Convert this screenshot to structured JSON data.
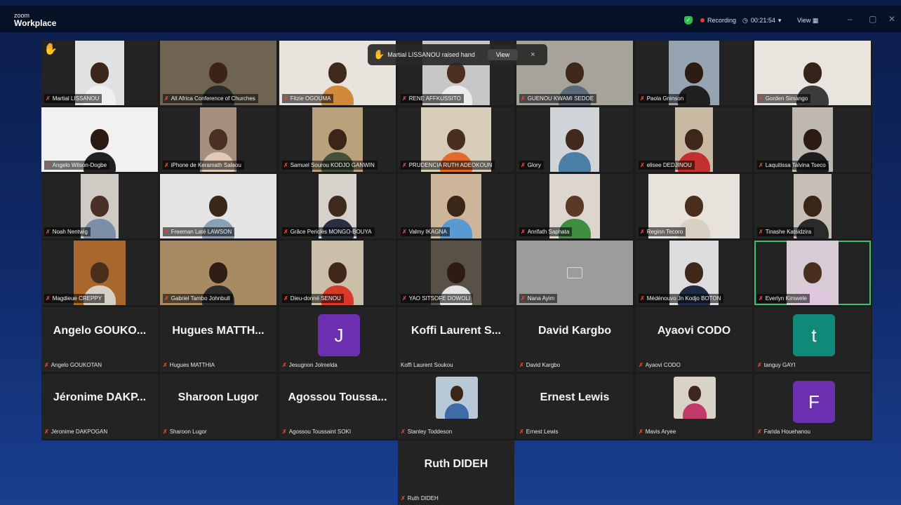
{
  "app": {
    "brand_small": "zoom",
    "brand_title": "Workplace"
  },
  "toolbar": {
    "recording": "Recording",
    "timer": "00:21:54",
    "timer_caret": "▾",
    "view": "View ▦",
    "minimize": "–",
    "maximize": "▢",
    "close": "✕"
  },
  "notification": {
    "text": "Martial LISSANOU raised hand",
    "view_label": "View",
    "close_label": "×"
  },
  "video_tiles": [
    {
      "name": "Martial LISSANOU",
      "bg": "#dfe1e2",
      "skin": "#3b261b",
      "shirt": "#f0f0f0",
      "hand": true
    },
    {
      "name": "All Africa Conference of Churches",
      "bg": "#6f6452",
      "skin": "#3a2417",
      "shirt": "#2b2b2b"
    },
    {
      "name": "Fitzie OGOUMA",
      "bg": "#e8e3dd",
      "skin": "#3f2a1b",
      "shirt": "#d08a3a"
    },
    {
      "name": "RENE AFFKUSSITO",
      "bg": "#c7c7c7",
      "skin": "#4b2f20",
      "shirt": "#ececec"
    },
    {
      "name": "GUENOU KWAMI SEDOE",
      "bg": "#a7a39b",
      "skin": "#3d281b",
      "shirt": "#5b6b7a"
    },
    {
      "name": "Paola Gninson",
      "bg": "#96a3b1",
      "skin": "#2d1c13",
      "shirt": "#202020"
    },
    {
      "name": "Gorden Simango",
      "bg": "#e9e4de",
      "skin": "#36231a",
      "shirt": "#3b3b3b"
    },
    {
      "name": "Angelo Wilson-Dogbe",
      "bg": "#f1f1f1",
      "skin": "#2b1b12",
      "shirt": "#222222"
    },
    {
      "name": "iPhone de Keramath Salaou",
      "bg": "#a48f7d",
      "skin": "#4a3022",
      "shirt": "#e0c8b4"
    },
    {
      "name": "Samuel Sourou KODJO GANWIN",
      "bg": "#b9a27b",
      "skin": "#3a2517",
      "shirt": "#42503a"
    },
    {
      "name": "PRUDENCIA RUTH ADEOKOUN",
      "bg": "#d8cdb9",
      "skin": "#4a2f1f",
      "shirt": "#e06b2d"
    },
    {
      "name": "Glory",
      "bg": "#cfd4d8",
      "skin": "#3f2a1d",
      "shirt": "#4c7fa6"
    },
    {
      "name": "elisee DEDJINOU",
      "bg": "#c9b9a2",
      "skin": "#3d271a",
      "shirt": "#c23030"
    },
    {
      "name": "Laquitissa Talvina Tseco",
      "bg": "#bfb8b1",
      "skin": "#2c1b12",
      "shirt": "#1e1e1e"
    },
    {
      "name": "Noah Nentwig",
      "bg": "#cfcac4",
      "skin": "#4a3024",
      "shirt": "#7b8fa8"
    },
    {
      "name": "Freeman Laté LAWSON",
      "bg": "#e4e4e4",
      "skin": "#3b261a",
      "shirt": "#8aa0b5"
    },
    {
      "name": "Grâce Periclès MONGO-BOUYA",
      "bg": "#d6d1ca",
      "skin": "#3f2a1e",
      "shirt": "#2b2f44"
    },
    {
      "name": "Valmy IKAGNA",
      "bg": "#cdb59a",
      "skin": "#3b261a",
      "shirt": "#5a9ad3"
    },
    {
      "name": "Anrifath Saphata",
      "bg": "#dcd6cf",
      "skin": "#5a3a26",
      "shirt": "#3f8d3f"
    },
    {
      "name": "Reginn Tecoro",
      "bg": "#e7e2db",
      "skin": "#4a2f1f",
      "shirt": "#d9d0c4"
    },
    {
      "name": "Tinashe Katsidzira",
      "bg": "#c7bfb5",
      "skin": "#3a2519",
      "shirt": "#2a2a2a"
    },
    {
      "name": "Magdieue CREPPY",
      "bg": "#a8672c",
      "skin": "#4a2e1c",
      "shirt": "#d6cfc5"
    },
    {
      "name": "Gabriel Tambo Johnbull",
      "bg": "#a88a63",
      "skin": "#2f1e14",
      "shirt": "#2c2c2c"
    },
    {
      "name": "Dieu-donné SENOU",
      "bg": "#cbbea9",
      "skin": "#3f281a",
      "shirt": "#d83a2a"
    },
    {
      "name": "YAO SITSOFE DOWOLI",
      "bg": "#5a5146",
      "skin": "#2d1c13",
      "shirt": "#e3e3e3"
    },
    {
      "name": "Nana Ayim",
      "bg": "#9c9c9c",
      "skin": "",
      "shirt": "",
      "off": true
    },
    {
      "name": "Médénouvo Jn Kodjo BOTON",
      "bg": "#dcdcdc",
      "skin": "#3f281a",
      "shirt": "#1f2a44"
    },
    {
      "name": "Everlyn Kimwele",
      "bg": "#d7ccd5",
      "skin": "#4a2f21",
      "shirt": "#e0c7e0",
      "active": true
    }
  ],
  "name_tiles": [
    {
      "big": "Angelo GOUKO...",
      "small": "Angelo GOUKOTAN",
      "mic": true
    },
    {
      "big": "Hugues MATTH...",
      "small": "Hugues MATTHIA",
      "mic": true
    },
    {
      "letter": "J",
      "color": "#6b2fb0",
      "small": "Jesugnon Jolmelda",
      "mic": true
    },
    {
      "big": "Koffi Laurent S...",
      "small": "Koffi Laurent Soukou",
      "mic": false
    },
    {
      "big": "David Kargbo",
      "small": "David Kargbo",
      "mic": true
    },
    {
      "big": "Ayaovi CODO",
      "small": "Ayaovi CODO",
      "mic": true
    },
    {
      "letter": "t",
      "color": "#0f8a78",
      "small": "tanguy GAYI",
      "mic": true
    },
    {
      "big": "Jéronime DAKP...",
      "small": "Jéronime DAKPOGAN",
      "mic": true
    },
    {
      "big": "Sharoon Lugor",
      "small": "Sharoon Lugor",
      "mic": true
    },
    {
      "big": "Agossou Toussa...",
      "small": "Agossou Toussaint SOKI",
      "mic": true
    },
    {
      "photo": true,
      "bg": "#b8c8d6",
      "skin": "#3a2619",
      "shirt": "#3f6ca8",
      "small": "Stanley Toddeson",
      "mic": true
    },
    {
      "big": "Ernest Lewis",
      "small": "Ernest Lewis",
      "mic": true
    },
    {
      "photo": true,
      "bg": "#d9d2c6",
      "skin": "#3d281b",
      "shirt": "#c23a6a",
      "small": "Mavis Aryee",
      "mic": true
    },
    {
      "letter": "F",
      "color": "#6b2fb0",
      "small": "Farida Houehanou",
      "mic": true
    },
    {
      "big": "Ruth DIDEH",
      "small": "Ruth DIDEH",
      "mic": true
    }
  ]
}
